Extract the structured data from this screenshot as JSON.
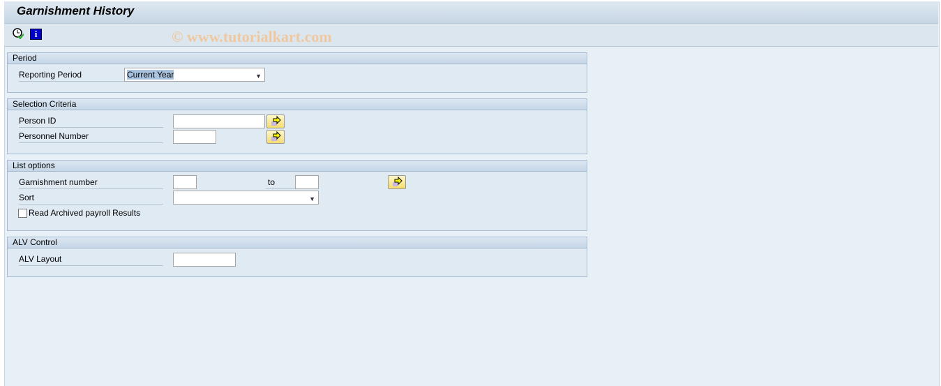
{
  "title": "Garnishment History",
  "toolbar": {
    "icons": [
      "execute-clock-icon",
      "info-icon"
    ]
  },
  "watermark": "© www.tutorialkart.com",
  "period": {
    "header": "Period",
    "reporting_period_label": "Reporting Period",
    "reporting_period_value": "Current Year"
  },
  "selection": {
    "header": "Selection Criteria",
    "person_id_label": "Person ID",
    "person_id_value": "",
    "personnel_number_label": "Personnel Number",
    "personnel_number_value": ""
  },
  "list": {
    "header": "List options",
    "garnishment_label": "Garnishment number",
    "to_label": "to",
    "sort_label": "Sort",
    "archived_label": "Read Archived payroll Results",
    "archived_checked": false
  },
  "alv": {
    "header": "ALV Control",
    "layout_label": "ALV Layout",
    "layout_value": ""
  }
}
